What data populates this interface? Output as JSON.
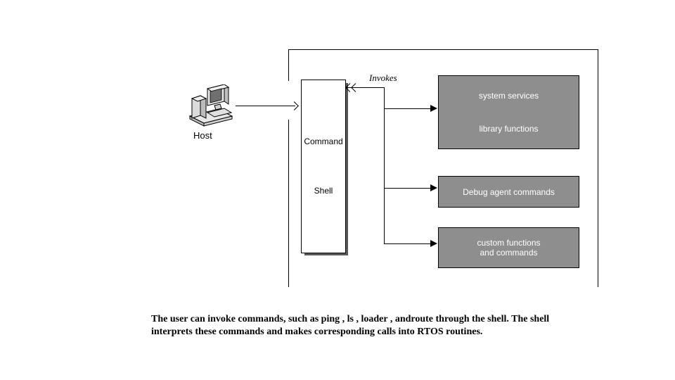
{
  "diagram": {
    "host_label": "Host",
    "cmd_shell": {
      "line1": "Command",
      "line2": "Shell"
    },
    "invokes_label": "Invokes",
    "boxes": {
      "services": {
        "l1": "system services",
        "l2": "library functions"
      },
      "debug": {
        "l1": "Debug agent commands"
      },
      "custom": {
        "l1": "custom functions",
        "l2": "and commands"
      }
    }
  },
  "caption": "The user can invoke commands, such as ping , ls , loader , androute through the shell. The shell interprets these commands and makes corresponding calls into RTOS routines."
}
